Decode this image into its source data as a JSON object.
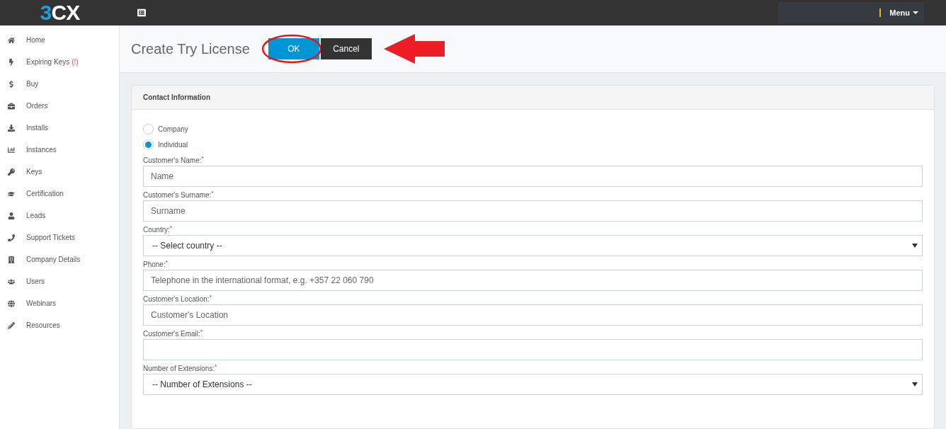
{
  "topbar": {
    "logo_prefix": "3",
    "logo_suffix": "CX",
    "menu": "Menu"
  },
  "sidebar": {
    "items": [
      {
        "label": "Home",
        "selected": false
      },
      {
        "label": "Expiring Keys",
        "alert": "(!)",
        "selected": false
      },
      {
        "label": "Buy",
        "selected": false
      },
      {
        "label": "Orders",
        "selected": false
      },
      {
        "label": "Installs",
        "selected": false
      },
      {
        "label": "Instances",
        "selected": false
      },
      {
        "label": "Keys",
        "selected": false
      },
      {
        "label": "Certification",
        "selected": false
      },
      {
        "label": "Leads",
        "selected": false
      },
      {
        "label": "Support Tickets",
        "selected": false
      },
      {
        "label": "Company Details",
        "selected": false
      },
      {
        "label": "Users",
        "selected": false
      },
      {
        "label": "Webinars",
        "selected": false
      },
      {
        "label": "Resources",
        "selected": false
      }
    ]
  },
  "page": {
    "title": "Create Try License",
    "buttons": [
      {
        "label": "OK",
        "kind": "primary"
      },
      {
        "label": "Cancel",
        "kind": "dark"
      }
    ]
  },
  "card": {
    "title": "Contact Information",
    "radios": [
      {
        "label": "Company",
        "selected": false
      },
      {
        "label": "Individual",
        "selected": true
      }
    ],
    "fields": [
      {
        "label": "Customer's Name:$^{*}$",
        "kind": "input",
        "placeholder": "Name"
      },
      {
        "label": "Customer's Surname:$^{*}$",
        "kind": "input",
        "placeholder": "Surname"
      },
      {
        "label": "Country:$^{*}$",
        "kind": "select",
        "value": "-- Select country --"
      },
      {
        "label": "Phone:$^{*}$",
        "kind": "input",
        "placeholder": "Telephone in the international format, e.g. +357 22 060 790"
      },
      {
        "label": "Customer's Location:$^{*}$",
        "kind": "input",
        "placeholder": "Customer's Location"
      },
      {
        "label": "Customer's Email:$^{*}$",
        "kind": "input"
      },
      {
        "label": "Number of Extensions:$^{*}$",
        "kind": "select",
        "value": "-- Number of Extensions --"
      }
    ]
  }
}
